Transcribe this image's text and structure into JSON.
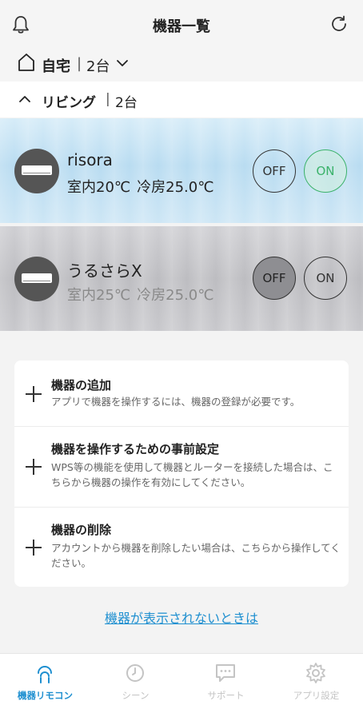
{
  "header": {
    "title": "機器一覧",
    "bell_icon": "bell-icon",
    "refresh_icon": "refresh-icon"
  },
  "home": {
    "label": "自宅",
    "separator": "|",
    "count": "2台"
  },
  "room": {
    "name": "リビング",
    "separator": "|",
    "count": "2台"
  },
  "devices": [
    {
      "name": "risora",
      "indoor": "室内20℃",
      "mode": "冷房25.0℃",
      "off_label": "OFF",
      "on_label": "ON",
      "state": "ON"
    },
    {
      "name": "うるさらX",
      "indoor": "室内25℃",
      "mode": "冷房25.0℃",
      "off_label": "OFF",
      "on_label": "ON",
      "state": "OFF"
    }
  ],
  "actions": [
    {
      "title": "機器の追加",
      "desc": "アプリで機器を操作するには、機器の登録が必要です。"
    },
    {
      "title": "機器を操作するための事前設定",
      "desc": "WPS等の機能を使用して機器とルーターを接続した場合は、こちらから機器の操作を有効にしてください。"
    },
    {
      "title": "機器の削除",
      "desc": "アカウントから機器を削除したい場合は、こちらから操作してください。"
    }
  ],
  "help_link": "機器が表示されないときは",
  "tabs": [
    {
      "label": "機器リモコン",
      "icon": "remote-icon",
      "active": true
    },
    {
      "label": "シーン",
      "icon": "clock-icon",
      "active": false
    },
    {
      "label": "サポート",
      "icon": "chat-icon",
      "active": false
    },
    {
      "label": "アプリ設定",
      "icon": "gear-icon",
      "active": false
    }
  ],
  "colors": {
    "accent": "#1e8fd0",
    "on_green": "#3bb26a"
  }
}
